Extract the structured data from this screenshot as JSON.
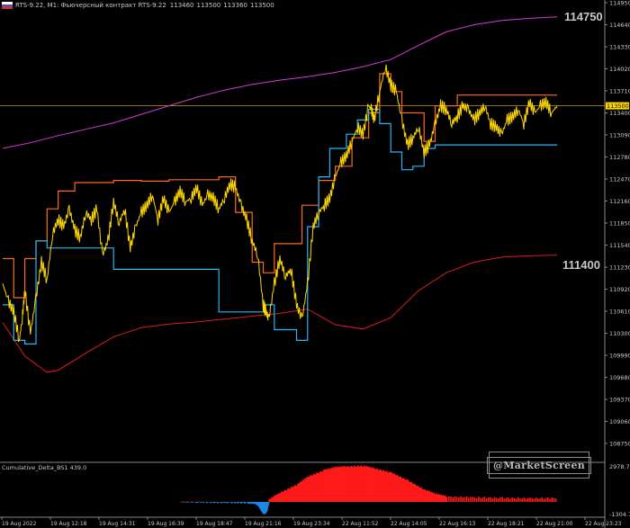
{
  "header": {
    "symbol": "RTS-9.22, M1:",
    "description": "Фьючерсный контракт RTS-9.22",
    "ohlc": [
      "113460",
      "113500",
      "113360",
      "113500"
    ]
  },
  "price_labels": {
    "upper_band": "114750",
    "lower_band": "111400",
    "current_price": "113500"
  },
  "indicator": {
    "title": "Cumulative_Delta_BS1 439.0",
    "axis_top": "2978.7",
    "axis_bottom": "-1304.7"
  },
  "watermark": "@MarketScreen",
  "colors": {
    "background": "#000000",
    "price_line": "#ffd700",
    "resistance": "#ff6a1a",
    "support": "#29b6f6",
    "upper_band": "#d63ad6",
    "lower_band": "#e01b1b",
    "current_price_line": "#c8a000",
    "delta_positive": "#ff1a1a",
    "delta_negative": "#1e88e5",
    "upper_label": "#d070d0",
    "lower_label": "#29a8f0"
  },
  "chart_data": {
    "type": "line",
    "price_axis": {
      "min": 109370,
      "max": 114950,
      "ticks": [
        "114950",
        "114640",
        "114330",
        "114020",
        "113710",
        "113400",
        "113090",
        "112780",
        "112470",
        "112160",
        "111850",
        "111540",
        "111230",
        "110920",
        "110610",
        "110300",
        "109990",
        "109680",
        "109370",
        "109060",
        "108750"
      ]
    },
    "time_axis": {
      "ticks": [
        "19 Aug 2022",
        "19 Aug 12:18",
        "19 Aug 14:31",
        "19 Aug 16:39",
        "19 Aug 18:47",
        "19 Aug 21:16",
        "19 Aug 23:34",
        "22 Aug 11:52",
        "22 Aug 14:05",
        "22 Aug 16:13",
        "22 Aug 18:21",
        "22 Aug 21:00",
        "22 Aug 23:23"
      ]
    },
    "current_price": 113500,
    "series": [
      {
        "name": "upper_band",
        "x": [
          0,
          0.05,
          0.1,
          0.15,
          0.2,
          0.25,
          0.3,
          0.35,
          0.4,
          0.45,
          0.5,
          0.55,
          0.6,
          0.65,
          0.7,
          0.75,
          0.8,
          0.85,
          0.9,
          0.95,
          1.0
        ],
        "values": [
          112900,
          112980,
          113080,
          113170,
          113260,
          113380,
          113500,
          113620,
          113720,
          113800,
          113860,
          113910,
          113970,
          114050,
          114150,
          114350,
          114540,
          114640,
          114700,
          114730,
          114750
        ]
      },
      {
        "name": "lower_band",
        "x": [
          0,
          0.04,
          0.08,
          0.1,
          0.15,
          0.2,
          0.25,
          0.3,
          0.35,
          0.4,
          0.45,
          0.5,
          0.55,
          0.6,
          0.65,
          0.7,
          0.75,
          0.8,
          0.85,
          0.9,
          0.95,
          1.0
        ],
        "values": [
          110450,
          109980,
          109750,
          109780,
          110020,
          110250,
          110380,
          110430,
          110460,
          110500,
          110540,
          110580,
          110640,
          110420,
          110360,
          110520,
          110900,
          111150,
          111300,
          111370,
          111390,
          111400
        ]
      },
      {
        "name": "resistance",
        "x": [
          0,
          0.02,
          0.02,
          0.04,
          0.04,
          0.06,
          0.06,
          0.08,
          0.08,
          0.1,
          0.1,
          0.13,
          0.13,
          0.2,
          0.2,
          0.25,
          0.25,
          0.3,
          0.3,
          0.39,
          0.39,
          0.42,
          0.42,
          0.45,
          0.45,
          0.47,
          0.47,
          0.49,
          0.49,
          0.54,
          0.54,
          0.57,
          0.57,
          0.6,
          0.6,
          0.63,
          0.63,
          0.66,
          0.66,
          0.68,
          0.68,
          0.7,
          0.7,
          0.72,
          0.72,
          0.76,
          0.76,
          0.78,
          0.78,
          0.82,
          0.82,
          1.0
        ],
        "values": [
          111350,
          111350,
          110800,
          110800,
          111350,
          111350,
          111600,
          111600,
          112050,
          112050,
          112300,
          112300,
          112420,
          112420,
          112450,
          112450,
          112440,
          112440,
          112460,
          112460,
          112500,
          112500,
          112000,
          112000,
          111300,
          111300,
          111150,
          111150,
          111560,
          111560,
          112100,
          112100,
          112450,
          112450,
          112650,
          112650,
          113050,
          113050,
          113400,
          113400,
          113950,
          113950,
          113700,
          113700,
          113400,
          113400,
          113000,
          113000,
          113500,
          113500,
          113650,
          113650
        ]
      },
      {
        "name": "support",
        "x": [
          0,
          0.02,
          0.02,
          0.04,
          0.04,
          0.06,
          0.06,
          0.08,
          0.08,
          0.13,
          0.13,
          0.2,
          0.2,
          0.3,
          0.3,
          0.39,
          0.39,
          0.47,
          0.47,
          0.49,
          0.49,
          0.53,
          0.53,
          0.55,
          0.55,
          0.57,
          0.57,
          0.59,
          0.59,
          0.62,
          0.62,
          0.64,
          0.64,
          0.66,
          0.66,
          0.68,
          0.68,
          0.7,
          0.7,
          0.72,
          0.72,
          0.74,
          0.74,
          0.76,
          0.76,
          0.78,
          0.78,
          1.0
        ],
        "values": [
          110700,
          110700,
          110200,
          110200,
          110150,
          110150,
          111600,
          111600,
          111500,
          111500,
          111500,
          111500,
          111200,
          111200,
          111200,
          111200,
          110600,
          110600,
          110700,
          110700,
          110350,
          110350,
          110200,
          110200,
          111800,
          111800,
          112500,
          112500,
          112900,
          112900,
          113100,
          113100,
          113300,
          113300,
          113450,
          113450,
          113250,
          113250,
          112850,
          112850,
          112600,
          112600,
          112650,
          112650,
          112900,
          112900,
          112950,
          112950
        ]
      },
      {
        "name": "price",
        "x": [
          0,
          0.01,
          0.02,
          0.03,
          0.035,
          0.04,
          0.05,
          0.06,
          0.07,
          0.08,
          0.09,
          0.1,
          0.11,
          0.12,
          0.13,
          0.14,
          0.15,
          0.16,
          0.17,
          0.18,
          0.19,
          0.2,
          0.21,
          0.22,
          0.23,
          0.24,
          0.25,
          0.26,
          0.27,
          0.28,
          0.29,
          0.3,
          0.31,
          0.32,
          0.33,
          0.34,
          0.35,
          0.36,
          0.37,
          0.38,
          0.39,
          0.4,
          0.41,
          0.42,
          0.43,
          0.44,
          0.45,
          0.46,
          0.47,
          0.475,
          0.48,
          0.49,
          0.5,
          0.51,
          0.52,
          0.53,
          0.54,
          0.55,
          0.56,
          0.57,
          0.58,
          0.59,
          0.6,
          0.61,
          0.62,
          0.63,
          0.64,
          0.65,
          0.66,
          0.665,
          0.67,
          0.68,
          0.69,
          0.7,
          0.71,
          0.72,
          0.73,
          0.74,
          0.75,
          0.76,
          0.77,
          0.78,
          0.79,
          0.8,
          0.81,
          0.82,
          0.83,
          0.84,
          0.85,
          0.86,
          0.87,
          0.88,
          0.89,
          0.9,
          0.91,
          0.92,
          0.93,
          0.94,
          0.95,
          0.96,
          0.97,
          0.98,
          0.99,
          1.0
        ],
        "values": [
          111000,
          110750,
          110600,
          110200,
          110500,
          110900,
          110300,
          110800,
          111300,
          111050,
          111700,
          111900,
          111800,
          112050,
          111750,
          111650,
          112000,
          111900,
          112050,
          111400,
          111600,
          112150,
          111850,
          112050,
          111500,
          111800,
          112000,
          112100,
          112250,
          111900,
          112200,
          112000,
          112150,
          112300,
          112150,
          112200,
          112350,
          112100,
          112250,
          112200,
          112050,
          112200,
          112400,
          112350,
          112100,
          111900,
          111600,
          111400,
          110700,
          110600,
          110500,
          111000,
          111350,
          111100,
          111200,
          110700,
          110500,
          111000,
          111800,
          112000,
          112100,
          112200,
          112500,
          112700,
          112800,
          113000,
          113200,
          113100,
          113500,
          113450,
          113300,
          113700,
          114050,
          113800,
          113700,
          113300,
          112950,
          113050,
          113200,
          112850,
          112950,
          113250,
          113500,
          113450,
          113250,
          113350,
          113500,
          113450,
          113300,
          113400,
          113500,
          113250,
          113200,
          113100,
          113300,
          113350,
          113450,
          113250,
          113550,
          113400,
          113500,
          113550,
          113400,
          113500
        ]
      }
    ],
    "delta": {
      "x": [
        0.32,
        0.35,
        0.38,
        0.41,
        0.44,
        0.455,
        0.46,
        0.465,
        0.47,
        0.475,
        0.48,
        0.5,
        0.53,
        0.55,
        0.58,
        0.6,
        0.62,
        0.65,
        0.67,
        0.7,
        0.73,
        0.76,
        0.78,
        0.8,
        0.85,
        0.9,
        0.95,
        1.0
      ],
      "values": [
        0,
        -20,
        -40,
        -60,
        -80,
        -120,
        -250,
        -600,
        -900,
        -700,
        200,
        700,
        1300,
        1900,
        2400,
        2600,
        2650,
        2700,
        2500,
        2200,
        1600,
        900,
        600,
        400,
        350,
        300,
        280,
        300
      ]
    }
  }
}
